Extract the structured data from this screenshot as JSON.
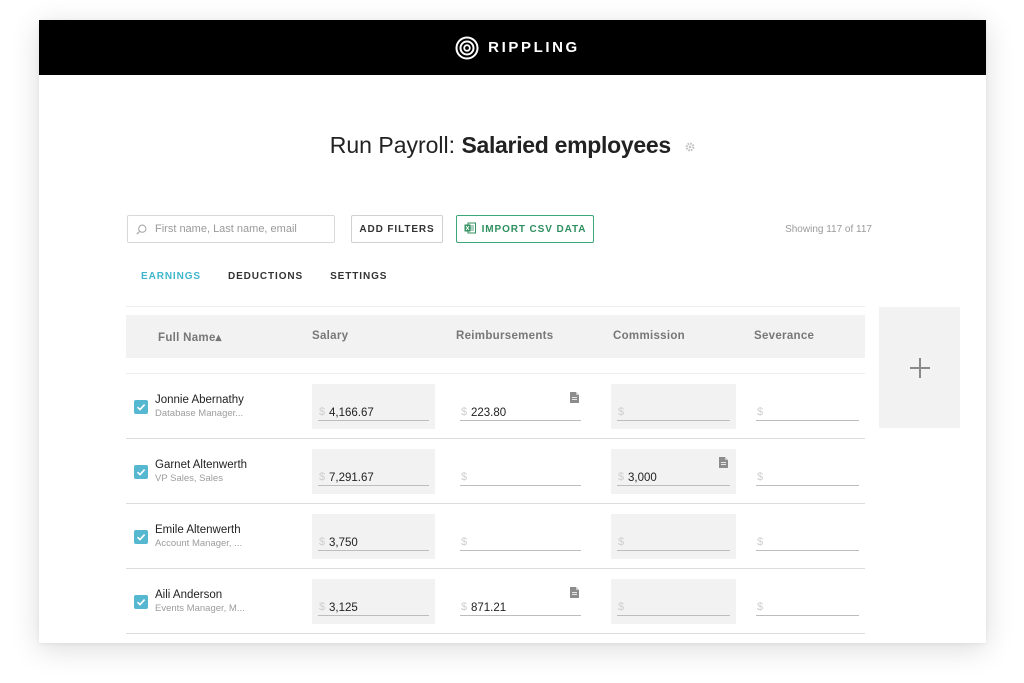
{
  "app": {
    "logo_text": "RIPPLING"
  },
  "page": {
    "title_prefix": "Run Payroll:",
    "title_main": "Salaried employees",
    "settings_icon": "gear-icon"
  },
  "toolbar": {
    "search_placeholder": "First name, Last name, email",
    "add_filters_label": "ADD FILTERS",
    "import_label": "IMPORT CSV DATA",
    "import_icon": "excel-icon",
    "showing_text": "Showing 117 of 117"
  },
  "tabs": [
    {
      "label": "EARNINGS",
      "active": true
    },
    {
      "label": "DEDUCTIONS",
      "active": false
    },
    {
      "label": "SETTINGS",
      "active": false
    }
  ],
  "table": {
    "columns": [
      "Full Name▴",
      "Salary",
      "Reimbursements",
      "Commission",
      "Severance"
    ],
    "currency_symbol": "$",
    "add_column_icon": "plus-icon",
    "rows": [
      {
        "name": "Jonnie Abernathy",
        "title": "Database Manager...",
        "checked": true,
        "salary": "4,166.67",
        "reimbursements": "223.80",
        "commission": "",
        "severance": "",
        "reimb_note": true,
        "comm_note": false
      },
      {
        "name": "Garnet Altenwerth",
        "title": "VP Sales, Sales",
        "checked": true,
        "salary": "7,291.67",
        "reimbursements": "",
        "commission": "3,000",
        "severance": "",
        "reimb_note": false,
        "comm_note": true
      },
      {
        "name": "Emile Altenwerth",
        "title": "Account Manager, ...",
        "checked": true,
        "salary": "3,750",
        "reimbursements": "",
        "commission": "",
        "severance": "",
        "reimb_note": false,
        "comm_note": false
      },
      {
        "name": "Aili Anderson",
        "title": "Events Manager, M...",
        "checked": true,
        "salary": "3,125",
        "reimbursements": "871.21",
        "commission": "",
        "severance": "",
        "reimb_note": true,
        "comm_note": false
      }
    ]
  },
  "colors": {
    "accent": "#3fb6cc",
    "checkbox": "#56b8d0",
    "import_green": "#2f8f5f",
    "topbar": "#000000"
  }
}
